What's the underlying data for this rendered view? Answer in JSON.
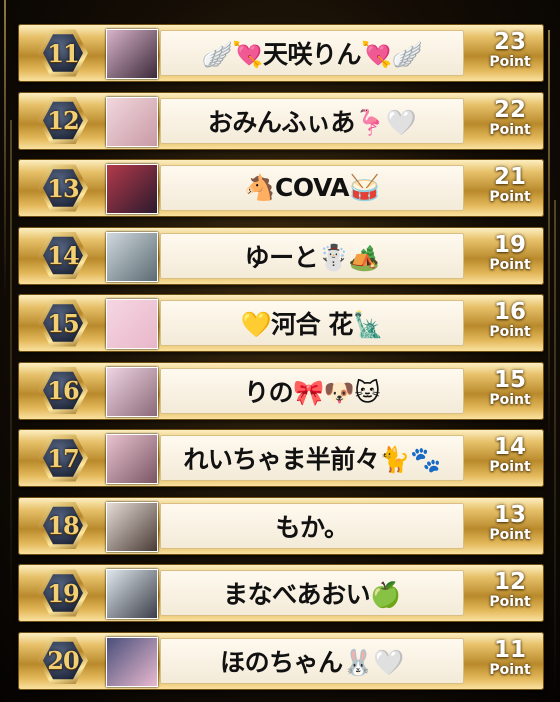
{
  "ranking": [
    {
      "rank": "11",
      "name": "🪽💘天咲りん💘🪽",
      "points": "23",
      "unit": "Point",
      "thumb_colors": [
        "#d9b3c8",
        "#3b2a3a"
      ]
    },
    {
      "rank": "12",
      "name": "おみんふぃあ🦩🤍",
      "points": "22",
      "unit": "Point",
      "thumb_colors": [
        "#f2d7dd",
        "#c99aa6"
      ]
    },
    {
      "rank": "13",
      "name": "🐴COVA🥁",
      "points": "21",
      "unit": "Point",
      "thumb_colors": [
        "#b23a4a",
        "#2c1a2e"
      ]
    },
    {
      "rank": "14",
      "name": "ゆーと☃️🏕️",
      "points": "19",
      "unit": "Point",
      "thumb_colors": [
        "#cfd8de",
        "#5c6b72"
      ]
    },
    {
      "rank": "15",
      "name": "💛河合 花🗽",
      "points": "16",
      "unit": "Point",
      "thumb_colors": [
        "#f6d6e2",
        "#e8b7c9"
      ]
    },
    {
      "rank": "16",
      "name": "りの🎀🐶🐱",
      "points": "15",
      "unit": "Point",
      "thumb_colors": [
        "#efd4e4",
        "#8b6a78"
      ]
    },
    {
      "rank": "17",
      "name": "れいちゃま半前々🐈🐾",
      "points": "14",
      "unit": "Point",
      "thumb_colors": [
        "#e9c3cf",
        "#7a5564"
      ]
    },
    {
      "rank": "18",
      "name": "もか。",
      "points": "13",
      "unit": "Point",
      "thumb_colors": [
        "#e6ddd6",
        "#4a3b36"
      ]
    },
    {
      "rank": "19",
      "name": "まなべあおい🍏",
      "points": "12",
      "unit": "Point",
      "thumb_colors": [
        "#dfe7ec",
        "#3c3f4a"
      ]
    },
    {
      "rank": "20",
      "name": "ほのちゃん🐰🤍",
      "points": "11",
      "unit": "Point",
      "thumb_colors": [
        "#4a4f7a",
        "#e9b9cf"
      ]
    }
  ]
}
